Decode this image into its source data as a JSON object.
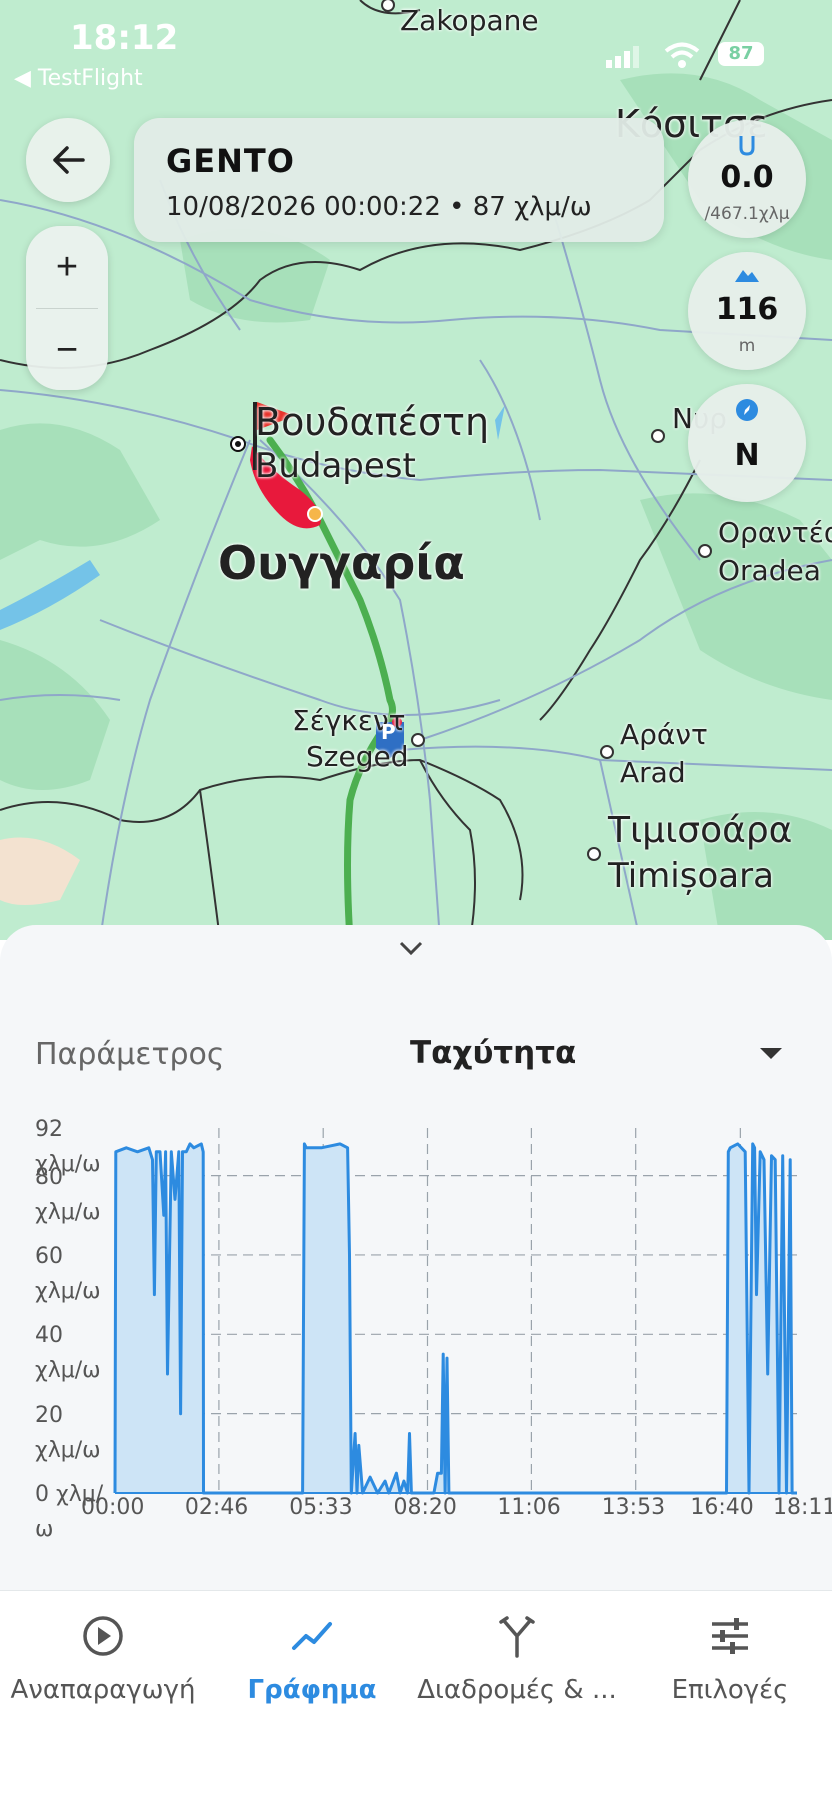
{
  "status_bar": {
    "time": "18:12",
    "back_app": "◀ TestFlight",
    "battery": "87"
  },
  "header": {
    "track_name": "GENTO",
    "subtitle": "10/08/2026 00:00:22 • 87 χλμ/ω"
  },
  "stats": [
    {
      "icon": "route-icon",
      "value": "0.0",
      "unit": "/467.1χλμ"
    },
    {
      "icon": "altitude-icon",
      "value": "116",
      "unit": "m"
    },
    {
      "icon": "compass-icon",
      "value": "N",
      "unit": ""
    }
  ],
  "zoom": {
    "in": "+",
    "out": "−"
  },
  "map_labels": {
    "zakopane": "Zakopane",
    "kosice": "Κόσιτσε",
    "budapest_gr": "Βουδαπέστη",
    "budapest_en": "Budapest",
    "hungary": "Ουγγαρία",
    "oradea_gr": "Οραντέα",
    "oradea_en": "Oradea",
    "szeged_gr": "Σέγκεντ",
    "szeged_en": "Szeged",
    "arad_gr": "Αράντ",
    "arad_en": "Arad",
    "timisoara_gr": "Τιμισοάρα",
    "timisoara_en": "Timișoara",
    "nyir": "Νυρ",
    "parking": "P"
  },
  "panel": {
    "parameter_label": "Παράμετρος",
    "parameter_value": "Ταχύτητα"
  },
  "chart_data": {
    "type": "area",
    "title": "",
    "xlabel": "",
    "ylabel": "",
    "y_ticks": [
      "92 χλμ/ω",
      "80 χλμ/ω",
      "60 χλμ/ω",
      "40 χλμ/ω",
      "20 χλμ/ω",
      "0 χλμ/ω"
    ],
    "x_ticks": [
      "00:00",
      "02:46",
      "05:33",
      "08:20",
      "11:06",
      "13:53",
      "16:40",
      "18:11"
    ],
    "ylim": [
      0,
      92
    ],
    "xlim_hours": [
      0,
      18.18
    ],
    "series": [
      {
        "x_hours": [
          0.0,
          0.02,
          0.3,
          0.6,
          0.9,
          1.0,
          1.05,
          1.1,
          1.2,
          1.3,
          1.35,
          1.4,
          1.5,
          1.6,
          1.7,
          1.75,
          1.8,
          1.9,
          2.0,
          2.1,
          2.3,
          2.35,
          2.36,
          5.0,
          5.05,
          5.1,
          5.5,
          6.0,
          6.2,
          6.25,
          6.3,
          6.4,
          6.45,
          6.5,
          6.6,
          6.8,
          7.0,
          7.2,
          7.3,
          7.5,
          7.6,
          7.7,
          7.8,
          7.85,
          7.9,
          8.0,
          8.5,
          8.6,
          8.7,
          8.75,
          8.8,
          8.85,
          8.9,
          9.0,
          16.3,
          16.35,
          16.4,
          16.6,
          16.8,
          16.9,
          17.0,
          17.05,
          17.1,
          17.2,
          17.3,
          17.4,
          17.5,
          17.6,
          17.7,
          17.8,
          17.9,
          18.0,
          18.05,
          18.1,
          18.18
        ],
        "speed": [
          0,
          86,
          87,
          86,
          87,
          84,
          50,
          86,
          86,
          70,
          86,
          30,
          86,
          74,
          86,
          20,
          86,
          86,
          88,
          87,
          88,
          86,
          0,
          0,
          88,
          87,
          87,
          88,
          87,
          60,
          0,
          15,
          0,
          12,
          0,
          4,
          0,
          3,
          0,
          5,
          0,
          3,
          0,
          15,
          0,
          0,
          0,
          5,
          5,
          35,
          0,
          34,
          0,
          0,
          0,
          86,
          87,
          88,
          86,
          0,
          88,
          87,
          50,
          86,
          84,
          30,
          85,
          84,
          0,
          85,
          0,
          84,
          0,
          0,
          0
        ]
      }
    ]
  },
  "tabs": [
    {
      "label": "Αναπαραγωγή",
      "icon": "play-icon",
      "active": false
    },
    {
      "label": "Γράφημα",
      "icon": "chart-icon",
      "active": true
    },
    {
      "label": "Διαδρομές & ...",
      "icon": "routes-split-icon",
      "active": false
    },
    {
      "label": "Επιλογές",
      "icon": "settings-sliders-icon",
      "active": false
    }
  ],
  "colors": {
    "accent": "#2d8be0",
    "route": "#4caf50",
    "map_bg": "#bfeccf",
    "track_red": "#e8193c"
  }
}
